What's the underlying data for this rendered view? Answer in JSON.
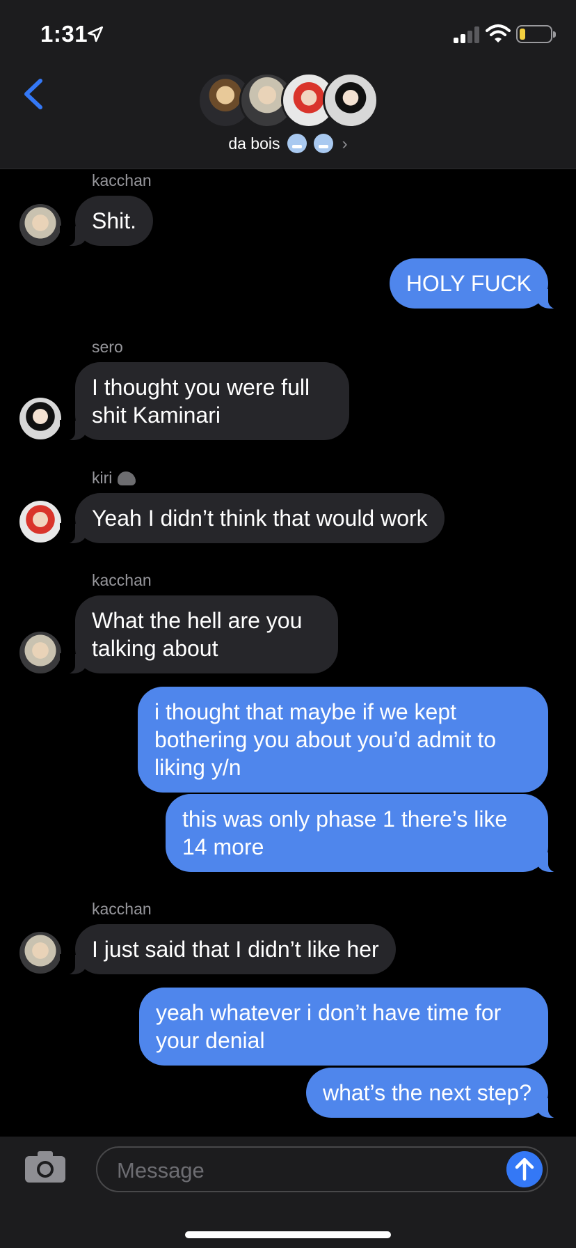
{
  "status_bar": {
    "time": "1:31",
    "battery_color": "#f4d03f"
  },
  "header": {
    "back_icon": "chevron-left-icon",
    "group_name": "da bois",
    "group_avatar_count": 4
  },
  "messages": [
    {
      "sender": "kacchan",
      "text": "Shit.",
      "direction": "in"
    },
    {
      "text": "HOLY FUCK",
      "direction": "out"
    },
    {
      "sender": "sero",
      "text": "I thought you were full shit Kaminari",
      "direction": "in"
    },
    {
      "sender": "kiri",
      "text": "Yeah I didn’t think that would work",
      "direction": "in"
    },
    {
      "sender": "kacchan",
      "text": "What the hell are you talking about",
      "direction": "in"
    },
    {
      "text": "i thought that maybe if we kept bothering you about you’d admit to liking y/n",
      "direction": "out"
    },
    {
      "text": "this was only phase 1 there’s like 14 more",
      "direction": "out"
    },
    {
      "sender": "kacchan",
      "text": "I just said that I didn’t like her",
      "direction": "in"
    },
    {
      "text": "yeah whatever i don’t have time for your denial",
      "direction": "out"
    },
    {
      "text": "what’s the next step?",
      "direction": "out"
    }
  ],
  "compose": {
    "placeholder": "Message"
  },
  "colors": {
    "outgoing": "#4f86ec",
    "incoming": "#26262a",
    "accent": "#3478f6"
  }
}
